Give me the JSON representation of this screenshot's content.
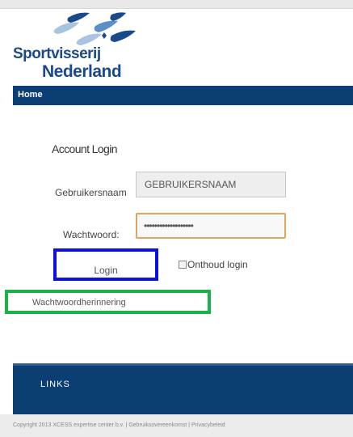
{
  "brand": {
    "line1": "Sportvisserij",
    "line2": "Nederland"
  },
  "nav": {
    "home": "Home"
  },
  "login": {
    "title": "Account Login",
    "username_label": "Gebruikersnaam",
    "username_value": "GEBRUIKERSNAAM",
    "password_label": "Wachtwoord:",
    "password_value": "•••••••••••••••••••",
    "login_button": "Login",
    "remember_label": "Onthoud login",
    "forgot_link": "Wachtwoordherinnering"
  },
  "footer": {
    "links_heading": "LINKS",
    "copyright": "Copyright 2013 XCESS expertise center b.v.",
    "separator": " | ",
    "terms": "Gebruiksovereenkomst",
    "privacy": "Privacybeleid"
  },
  "colors": {
    "nav_bg": "#0b3f74",
    "login_highlight": "#0a10e8",
    "forgot_highlight": "#1bb14a",
    "password_focus": "#e2a55a"
  }
}
